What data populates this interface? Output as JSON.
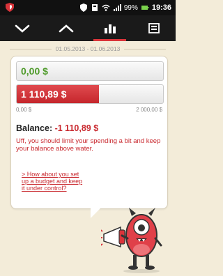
{
  "status_bar": {
    "battery_percent": "99%",
    "time": "19:36"
  },
  "toolbar": {
    "active_tab": "chart",
    "icons": [
      "chevron-down-icon",
      "chevron-up-icon",
      "bar-chart-icon",
      "notes-icon"
    ]
  },
  "period": {
    "range": "01.05.2013 - 01.06.2013"
  },
  "summary": {
    "income_value": "0,00  $",
    "expense_value": "1 110,89  $",
    "expense_fill_fraction": 0.56,
    "scale_min": "0,00  $",
    "scale_max": "2 000,00  $"
  },
  "balance": {
    "label": "Balance:",
    "amount": "-1 110,89  $"
  },
  "advice": {
    "message": "Uff, you should limit your spending a bit and keep your balance above water.",
    "link_text": "> How about you set up a budget and keep it under control?"
  },
  "colors": {
    "accent_red": "#c9292f",
    "positive_green": "#4e9a2a",
    "background": "#f3ecd9"
  }
}
